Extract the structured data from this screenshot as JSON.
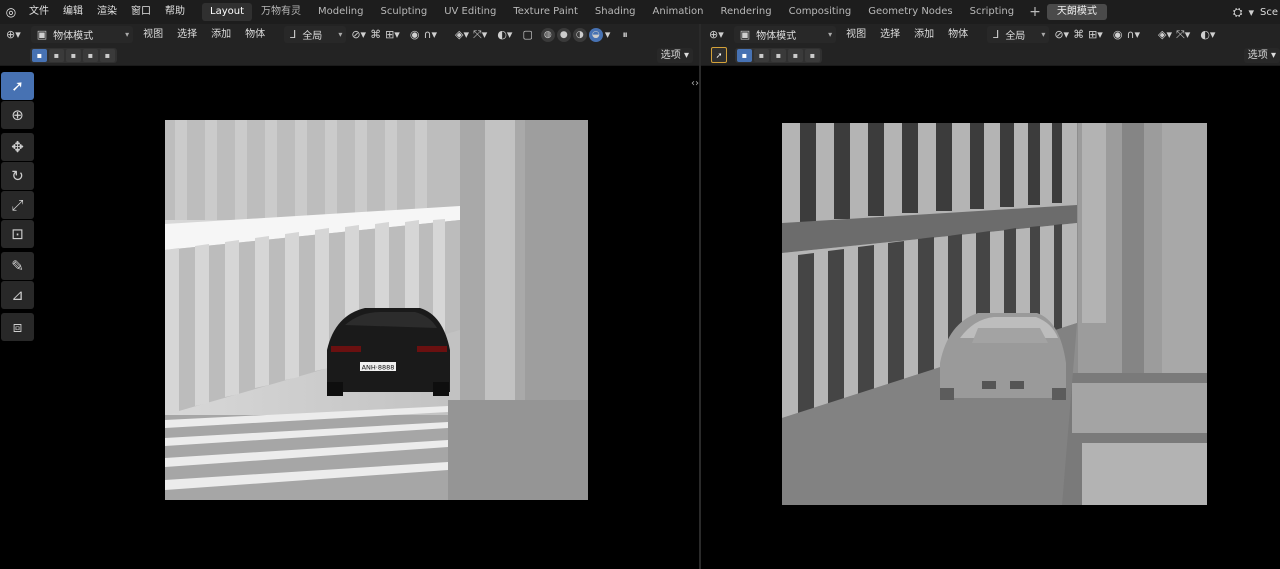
{
  "topbar": {
    "menus": [
      "文件",
      "编辑",
      "渲染",
      "窗口",
      "帮助"
    ],
    "workspaces": [
      {
        "label": "Layout",
        "active": true
      },
      {
        "label": "万物有灵",
        "active": false
      },
      {
        "label": "Modeling",
        "active": false
      },
      {
        "label": "Sculpting",
        "active": false
      },
      {
        "label": "UV Editing",
        "active": false
      },
      {
        "label": "Texture Paint",
        "active": false
      },
      {
        "label": "Shading",
        "active": false
      },
      {
        "label": "Animation",
        "active": false
      },
      {
        "label": "Rendering",
        "active": false
      },
      {
        "label": "Compositing",
        "active": false
      },
      {
        "label": "Geometry Nodes",
        "active": false
      },
      {
        "label": "Scripting",
        "active": false
      }
    ],
    "add_tab_label": "+",
    "special_tab_label": "天朗模式",
    "scene_label": "Sce"
  },
  "left_viewport": {
    "mode_label": "物体模式",
    "menus": [
      "视图",
      "选择",
      "添加",
      "物体"
    ],
    "orientation_label": "全局",
    "options_label": "选项"
  },
  "right_viewport": {
    "mode_label": "物体模式",
    "menus": [
      "视图",
      "选择",
      "添加",
      "物体"
    ],
    "orientation_label": "全局",
    "options_label": "选项"
  },
  "render": {
    "left_plate": "ANH·8888"
  },
  "colors": {
    "accent": "#4772b3",
    "header_bg": "#232323",
    "topbar_bg": "#1d1d1d"
  }
}
